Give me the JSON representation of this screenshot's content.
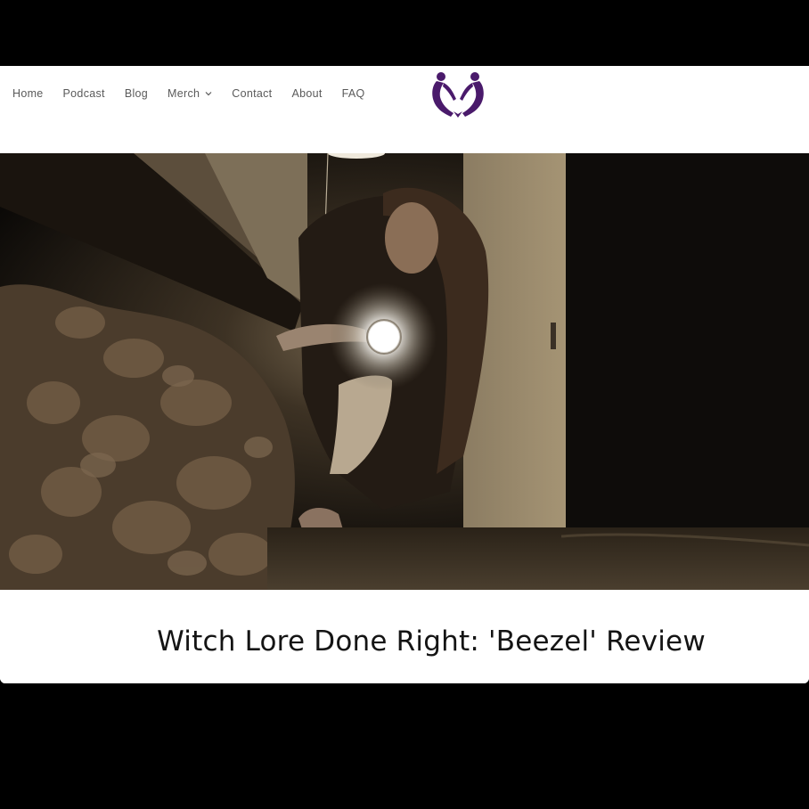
{
  "nav": {
    "items": [
      {
        "label": "Home"
      },
      {
        "label": "Podcast"
      },
      {
        "label": "Blog"
      },
      {
        "label": "Merch",
        "has_dropdown": true
      },
      {
        "label": "Contact"
      },
      {
        "label": "About"
      },
      {
        "label": "FAQ"
      }
    ]
  },
  "logo": {
    "icon": "twin-figures-heart-logo-icon",
    "color": "#4a1a6b"
  },
  "hero": {
    "image": "dark cellar scene: woman crouching with flashlight beside rocky earth and pale door"
  },
  "post": {
    "title": "Witch Lore Done Right: 'Beezel' Review"
  },
  "colors": {
    "page_background": "#000000",
    "header_background": "#ffffff",
    "nav_text": "#5a5a5a",
    "title_text": "#141414",
    "brand_purple": "#4a1a6b"
  }
}
